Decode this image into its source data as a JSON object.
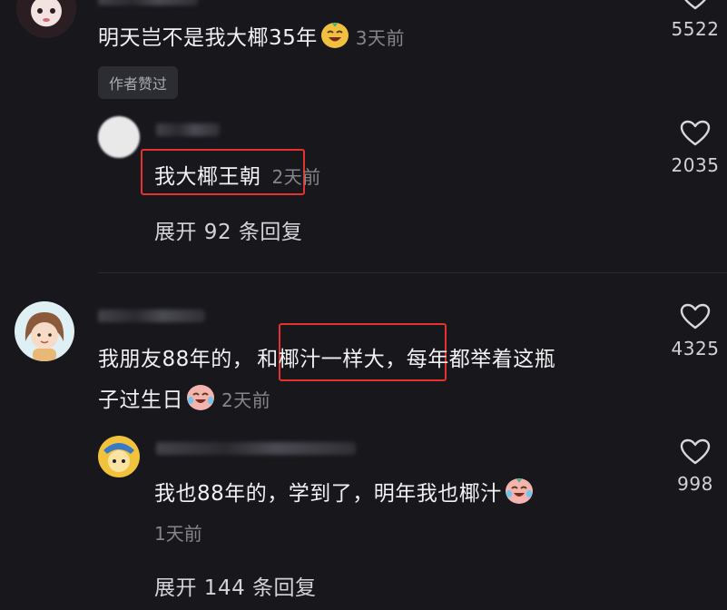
{
  "comments": [
    {
      "text": "明天岂不是我大椰35年",
      "time": "3天前",
      "likes": "5522",
      "badge": "作者赞过",
      "reply": {
        "text": "我大椰王朝",
        "time_digit": "2",
        "time_rest": "天前",
        "likes": "2035"
      },
      "expand": "展开 92 条回复"
    },
    {
      "text_before": "我朋友88年的，",
      "highlight": "和椰汁一样大",
      "text_after": "，每年都举着这瓶",
      "text_line2": "子过生日",
      "time": "2天前",
      "likes": "4325",
      "reply": {
        "text": "我也88年的，学到了，明年我也椰汁",
        "time": "1天前",
        "likes": "998"
      },
      "expand": "展开 144 条回复"
    }
  ],
  "colors": {
    "background": "#17171c",
    "highlight_box": "#e5322d",
    "secondary_text": "#85858b"
  },
  "icons": [
    "heart-icon",
    "laughing-emoji-icon",
    "crying-laughing-emoji-icon"
  ]
}
